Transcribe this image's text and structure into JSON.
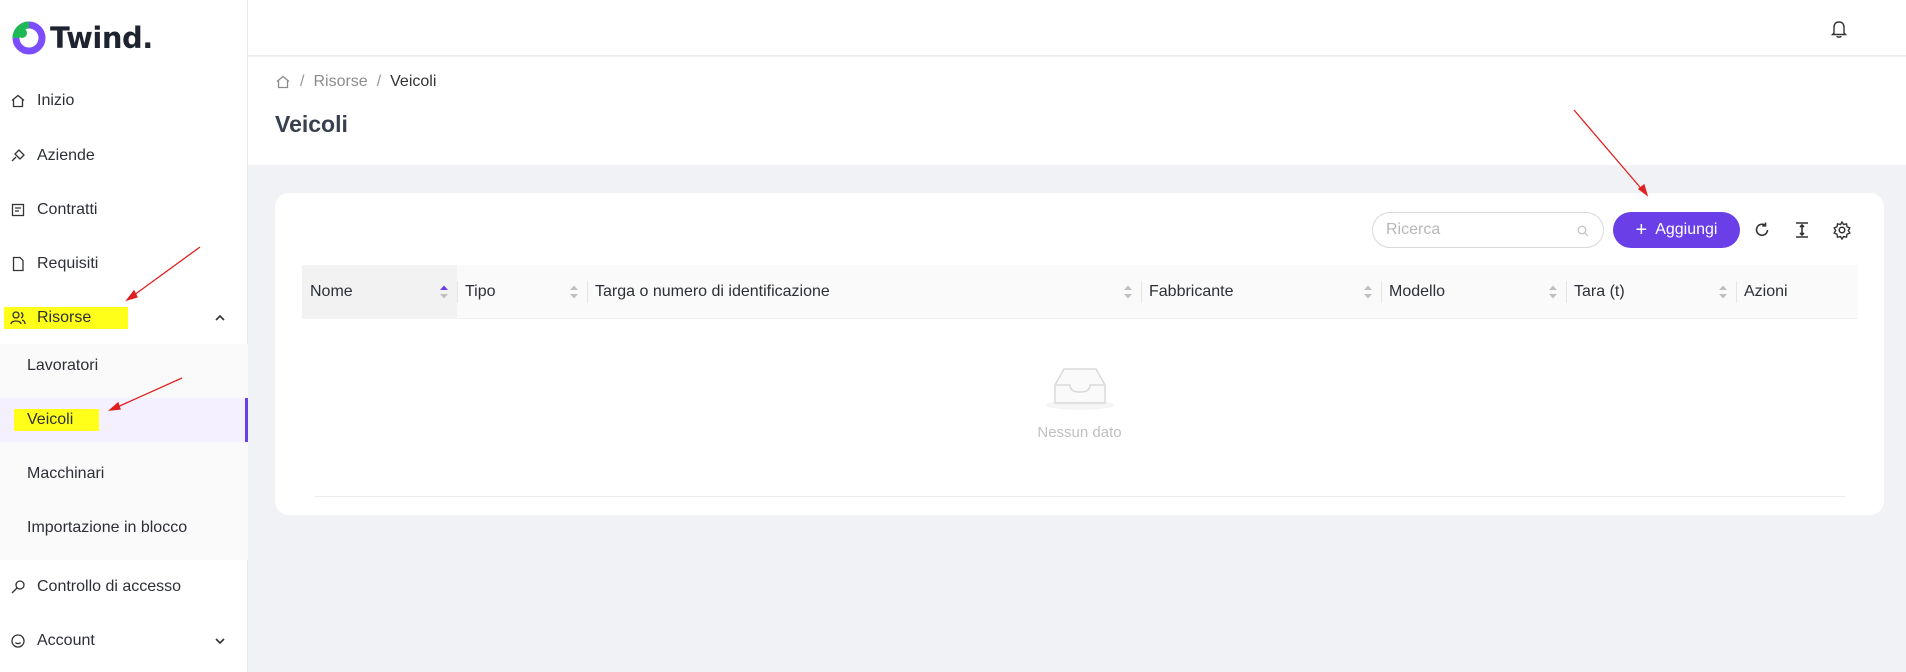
{
  "app": {
    "logo_text": "Twind."
  },
  "sidebar": {
    "items": [
      {
        "label": "Inizio"
      },
      {
        "label": "Aziende"
      },
      {
        "label": "Contratti"
      },
      {
        "label": "Requisiti"
      },
      {
        "label": "Risorse"
      },
      {
        "label": "Controllo di accesso"
      },
      {
        "label": "Account"
      }
    ],
    "submenu": [
      {
        "label": "Lavoratori"
      },
      {
        "label": "Veicoli"
      },
      {
        "label": "Macchinari"
      },
      {
        "label": "Importazione in blocco"
      }
    ]
  },
  "breadcrumb": {
    "sep": "/",
    "level1": "Risorse",
    "current": "Veicoli"
  },
  "page": {
    "title": "Veicoli"
  },
  "toolbar": {
    "search_placeholder": "Ricerca",
    "add_label": "Aggiungi"
  },
  "table": {
    "columns": [
      "Nome",
      "Tipo",
      "Targa o numero di identificazione",
      "Fabbricante",
      "Modello",
      "Tara (t)",
      "Azioni"
    ],
    "empty_text": "Nessun dato"
  },
  "colors": {
    "accent": "#6a3fe8",
    "highlight": "#ffff1a",
    "annotation": "#e02020"
  }
}
